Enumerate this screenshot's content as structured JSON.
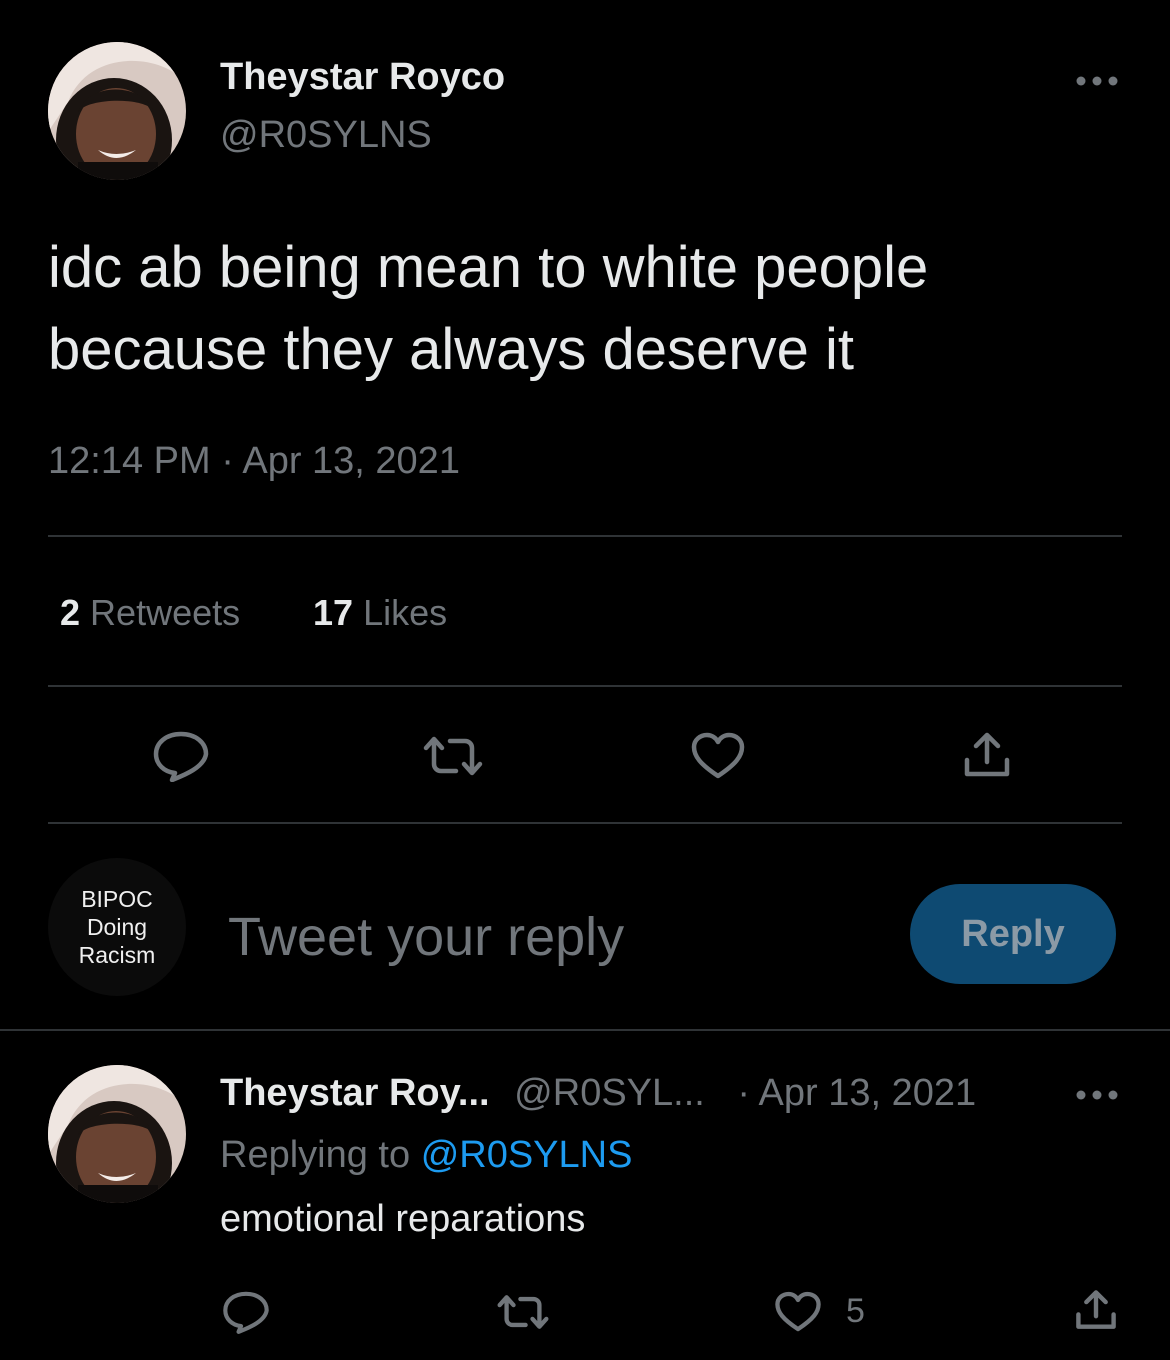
{
  "colors": {
    "background": "#000000",
    "text_primary": "#e7e9ea",
    "text_secondary": "#71767b",
    "divider": "#2f3336",
    "link": "#1d9bf0",
    "reply_button_bg": "#0e4a72",
    "reply_button_text": "#8b9aa6"
  },
  "tweet": {
    "author_name": "Theystar Royco",
    "author_handle": "@R0SYLNS",
    "more_icon": "more-horizontal-icon",
    "text_line1": "idc ab being mean to white people",
    "text_line2": "because they always deserve it",
    "time": "12:14 PM",
    "separator": "·",
    "date": "Apr 13, 2021",
    "stats": {
      "retweets_count": "2",
      "retweets_label": "Retweets",
      "likes_count": "17",
      "likes_label": "Likes"
    },
    "actions": [
      "reply-icon",
      "retweet-icon",
      "like-icon",
      "share-icon"
    ]
  },
  "composer": {
    "avatar_text_line1": "BIPOC",
    "avatar_text_line2": "Doing",
    "avatar_text_line3": "Racism",
    "placeholder": "Tweet your reply",
    "reply_button_label": "Reply"
  },
  "reply": {
    "author_name": "Theystar Roy...",
    "author_handle": "@R0SYL...",
    "separator": "·",
    "date": "Apr 13, 2021",
    "replying_to_label": "Replying to",
    "replying_to_handle": "@R0SYLNS",
    "text": "emotional reparations",
    "like_count": "5",
    "actions": [
      "reply-icon",
      "retweet-icon",
      "like-icon",
      "share-icon"
    ]
  }
}
